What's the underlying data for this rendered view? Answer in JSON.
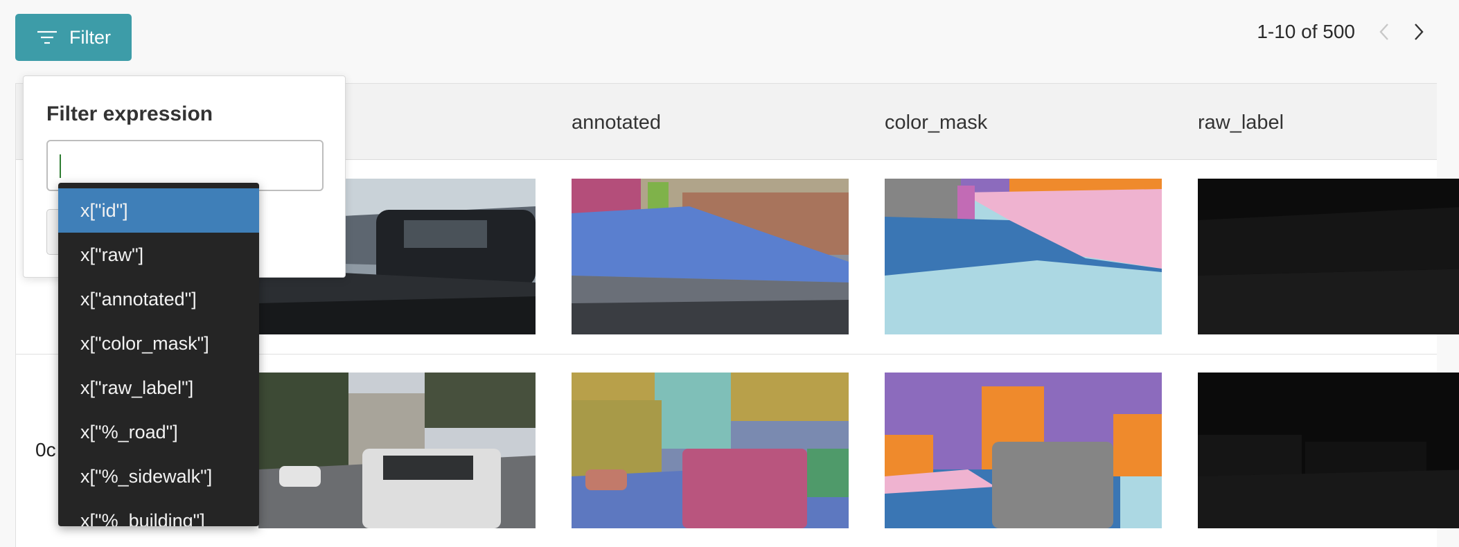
{
  "toolbar": {
    "filter_label": "Filter"
  },
  "pagination": {
    "range_text": "1-10 of 500"
  },
  "table": {
    "columns": [
      "annotated",
      "color_mask",
      "raw_label"
    ],
    "rows": [
      {
        "id": ""
      },
      {
        "id": "0c"
      }
    ]
  },
  "filter_popover": {
    "title": "Filter expression",
    "input_value": ""
  },
  "autocomplete": {
    "selected_index": 0,
    "items": [
      "x[\"id\"]",
      "x[\"raw\"]",
      "x[\"annotated\"]",
      "x[\"color_mask\"]",
      "x[\"raw_label\"]",
      "x[\"%_road\"]",
      "x[\"%_sidewalk\"]",
      "x[\"%_building\"]"
    ]
  },
  "colors": {
    "accent": "#3d9ca8",
    "dropdown_bg": "#252525",
    "dropdown_active": "#3f7fb8"
  }
}
